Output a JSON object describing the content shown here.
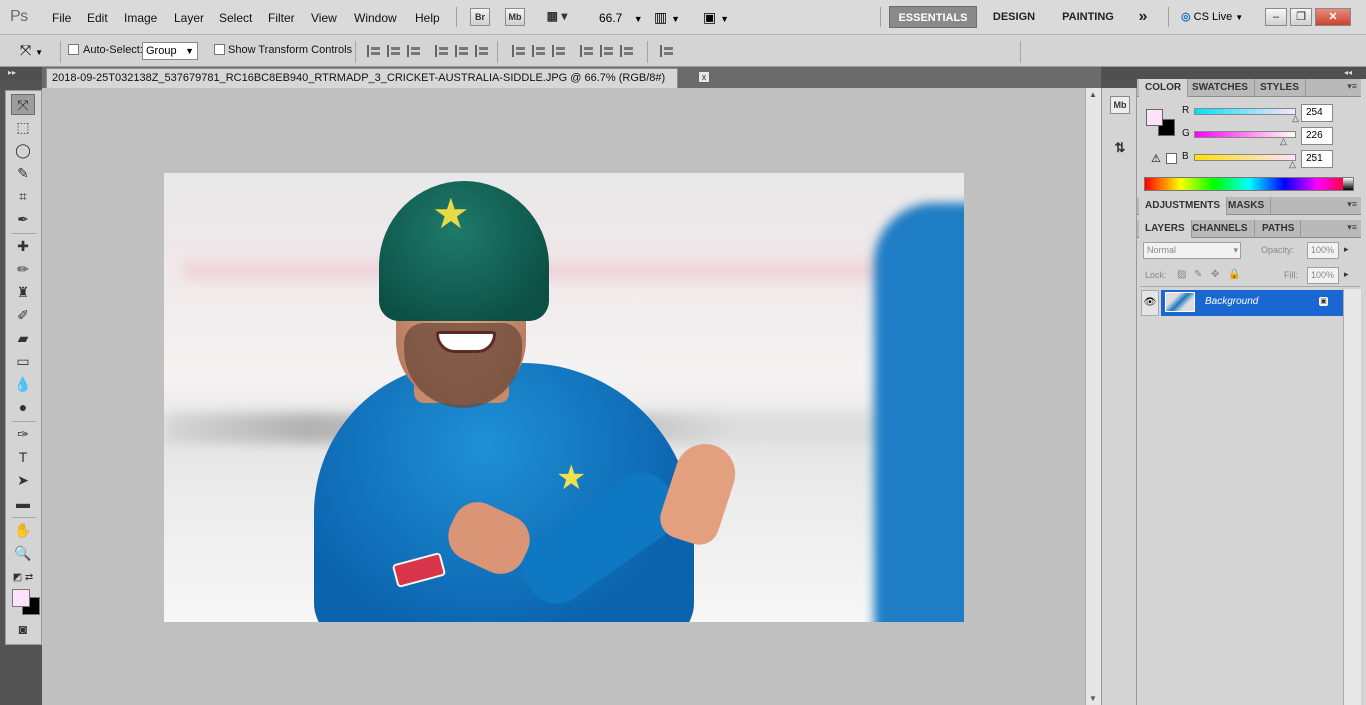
{
  "app": {
    "logo": "Ps"
  },
  "menu": [
    "File",
    "Edit",
    "Image",
    "Layer",
    "Select",
    "Filter",
    "View",
    "Window",
    "Help"
  ],
  "menubar": {
    "bridge_label": "Br",
    "mini_bridge_label": "Mb",
    "zoom_value": "66.7",
    "workspaces": [
      "ESSENTIALS",
      "DESIGN",
      "PAINTING"
    ],
    "more_label": "»",
    "cs_live": "CS Live"
  },
  "options": {
    "auto_select_label": "Auto-Select:",
    "group_value": "Group",
    "transform_label": "Show Transform Controls"
  },
  "document": {
    "tab_title": "2018-09-25T032138Z_537679781_RC16BC8EB940_RTRMADP_3_CRICKET-AUSTRALIA-SIDDLE.JPG @ 66.7% (RGB/8#)",
    "close_label": "x"
  },
  "right_column": {
    "mini_bridge": "Mb"
  },
  "color_panel": {
    "tabs": [
      "COLOR",
      "SWATCHES",
      "STYLES"
    ],
    "r_label": "R",
    "r_value": "254",
    "g_label": "G",
    "g_value": "226",
    "b_label": "B",
    "b_value": "251",
    "foreground": "#fee2fb",
    "background": "#000000"
  },
  "adjustments_panel": {
    "tabs": [
      "ADJUSTMENTS",
      "MASKS"
    ]
  },
  "layers_panel": {
    "tabs": [
      "LAYERS",
      "CHANNELS",
      "PATHS"
    ],
    "blend_mode": "Normal",
    "opacity_label": "Opacity:",
    "opacity_value": "100%",
    "lock_label": "Lock:",
    "fill_label": "Fill:",
    "fill_value": "100%",
    "layers": [
      {
        "name": "Background",
        "visible": true,
        "locked": true
      }
    ]
  },
  "icons": [
    "move-tool-icon",
    "marquee-icon",
    "lasso-icon",
    "quick-select-icon",
    "crop-icon",
    "eyedropper-icon",
    "healing-brush-icon",
    "brush-icon",
    "clone-stamp-icon",
    "history-brush-icon",
    "eraser-icon",
    "gradient-icon",
    "blur-icon",
    "dodge-icon",
    "pen-icon",
    "type-icon",
    "path-select-icon",
    "rectangle-icon",
    "hand-icon",
    "zoom-icon",
    "quick-mask-icon"
  ]
}
